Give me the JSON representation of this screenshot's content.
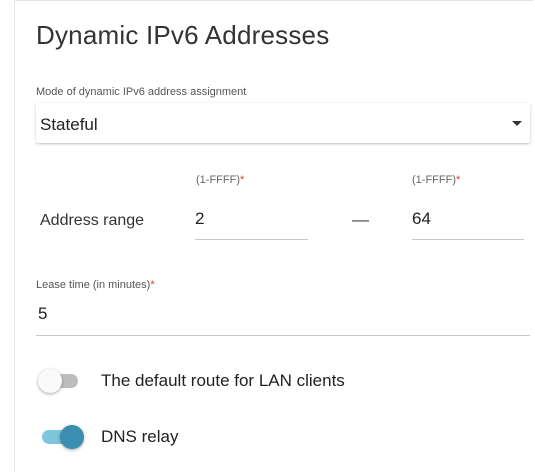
{
  "title": "Dynamic IPv6 Addresses",
  "mode": {
    "label": "Mode of dynamic IPv6 address assignment",
    "value": "Stateful"
  },
  "address_range": {
    "label": "Address range",
    "start": {
      "hint": "(1-FFFF)",
      "required_mark": "*",
      "value": "2"
    },
    "separator": "—",
    "end": {
      "hint": "(1-FFFF)",
      "required_mark": "*",
      "value": "64"
    }
  },
  "lease_time": {
    "label": "Lease time (in minutes)",
    "required_mark": "*",
    "value": "5"
  },
  "toggles": [
    {
      "label": "The default route for LAN clients",
      "state": "off"
    },
    {
      "label": "DNS relay",
      "state": "on"
    }
  ],
  "colors": {
    "required": "#e53935",
    "toggle_on_knob": "#3a8fb0",
    "toggle_on_track": "#7dc6dd",
    "toggle_off_track": "#bdbdbd"
  }
}
